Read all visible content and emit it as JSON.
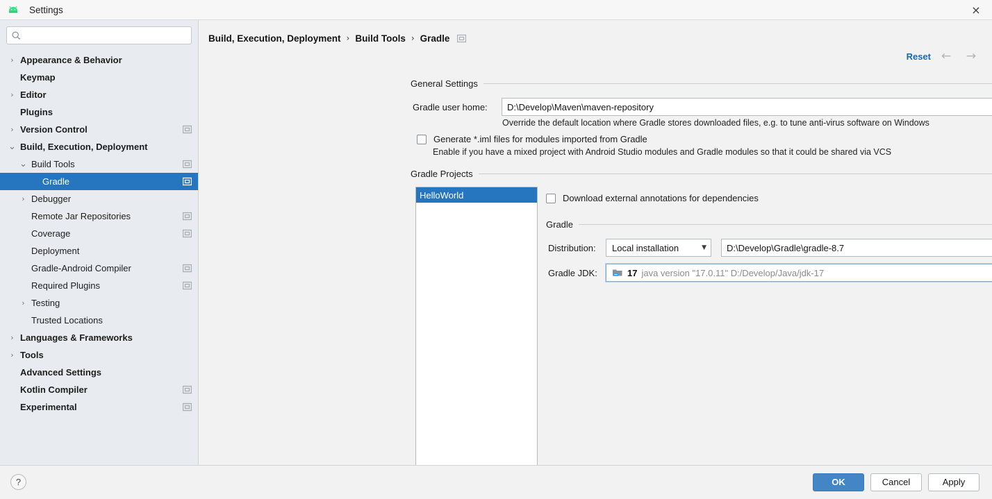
{
  "window": {
    "title": "Settings",
    "app_icon": "android-robot-icon",
    "close_label": "×"
  },
  "sidebar": {
    "search": {
      "placeholder": "",
      "value": "",
      "icon": "search-icon"
    },
    "items": [
      {
        "label": "Appearance & Behavior",
        "indent": 0,
        "bold": true,
        "arrow": "collapsed",
        "scope": false
      },
      {
        "label": "Keymap",
        "indent": 0,
        "bold": true,
        "arrow": "none",
        "scope": false
      },
      {
        "label": "Editor",
        "indent": 0,
        "bold": true,
        "arrow": "collapsed",
        "scope": false
      },
      {
        "label": "Plugins",
        "indent": 0,
        "bold": true,
        "arrow": "none",
        "scope": false
      },
      {
        "label": "Version Control",
        "indent": 0,
        "bold": true,
        "arrow": "collapsed",
        "scope": true
      },
      {
        "label": "Build, Execution, Deployment",
        "indent": 0,
        "bold": true,
        "arrow": "expanded",
        "scope": false
      },
      {
        "label": "Build Tools",
        "indent": 1,
        "bold": false,
        "arrow": "expanded",
        "scope": true
      },
      {
        "label": "Gradle",
        "indent": 2,
        "bold": false,
        "arrow": "none",
        "scope": true,
        "selected": true
      },
      {
        "label": "Debugger",
        "indent": 1,
        "bold": false,
        "arrow": "collapsed",
        "scope": false
      },
      {
        "label": "Remote Jar Repositories",
        "indent": 1,
        "bold": false,
        "arrow": "none",
        "scope": true
      },
      {
        "label": "Coverage",
        "indent": 1,
        "bold": false,
        "arrow": "none",
        "scope": true
      },
      {
        "label": "Deployment",
        "indent": 1,
        "bold": false,
        "arrow": "none",
        "scope": false
      },
      {
        "label": "Gradle-Android Compiler",
        "indent": 1,
        "bold": false,
        "arrow": "none",
        "scope": true
      },
      {
        "label": "Required Plugins",
        "indent": 1,
        "bold": false,
        "arrow": "none",
        "scope": true
      },
      {
        "label": "Testing",
        "indent": 1,
        "bold": false,
        "arrow": "collapsed",
        "scope": false
      },
      {
        "label": "Trusted Locations",
        "indent": 1,
        "bold": false,
        "arrow": "none",
        "scope": false
      },
      {
        "label": "Languages & Frameworks",
        "indent": 0,
        "bold": true,
        "arrow": "collapsed",
        "scope": false
      },
      {
        "label": "Tools",
        "indent": 0,
        "bold": true,
        "arrow": "collapsed",
        "scope": false
      },
      {
        "label": "Advanced Settings",
        "indent": 0,
        "bold": true,
        "arrow": "none",
        "scope": false
      },
      {
        "label": "Kotlin Compiler",
        "indent": 0,
        "bold": true,
        "arrow": "none",
        "scope": true
      },
      {
        "label": "Experimental",
        "indent": 0,
        "bold": true,
        "arrow": "none",
        "scope": true
      }
    ]
  },
  "header": {
    "breadcrumb": [
      "Build, Execution, Deployment",
      "Build Tools",
      "Gradle"
    ],
    "separator": "›",
    "scope_icon": "project-scope-icon",
    "reset_label": "Reset",
    "back_arrow": "←",
    "forward_arrow": "→"
  },
  "general_settings": {
    "group_title": "General Settings",
    "gradle_user_home": {
      "label": "Gradle user home:",
      "value": "D:\\Develop\\Maven\\maven-repository",
      "placeholder": "",
      "browse_icon": "folder-browse-icon"
    },
    "gradle_user_home_hint": "Override the default location where Gradle stores downloaded files, e.g. to tune anti-virus software on Windows",
    "generate_iml": {
      "label": "Generate *.iml files for modules imported from Gradle",
      "checked": false
    },
    "generate_iml_hint": "Enable if you have a mixed project with Android Studio modules and Gradle modules so that it could be shared via VCS"
  },
  "gradle_projects": {
    "group_title": "Gradle Projects",
    "projects": [
      {
        "name": "HelloWorld",
        "selected": true
      }
    ],
    "download_annotations": {
      "label": "Download external annotations for dependencies",
      "checked": false
    }
  },
  "gradle_section": {
    "group_title": "Gradle",
    "distribution": {
      "label": "Distribution:",
      "value": "Local installation",
      "caret": "▼"
    },
    "distribution_path": {
      "value": "D:\\Develop\\Gradle\\gradle-8.7",
      "placeholder": "",
      "browse_icon": "folder-browse-icon"
    },
    "gradle_jdk": {
      "label": "Gradle JDK:",
      "icon": "jdk-folder-icon",
      "version": "17",
      "description": "java version \"17.0.11\" D:/Develop/Java/jdk-17",
      "caret": "▼"
    }
  },
  "footer": {
    "help_label": "?",
    "ok_label": "OK",
    "cancel_label": "Cancel",
    "apply_label": "Apply"
  },
  "colors": {
    "accent_blue": "#2675bf",
    "link_blue": "#1769b5",
    "primary_button": "#4286c5",
    "sidebar_bg": "#e8ecf0",
    "content_bg": "#f2f2f2"
  }
}
